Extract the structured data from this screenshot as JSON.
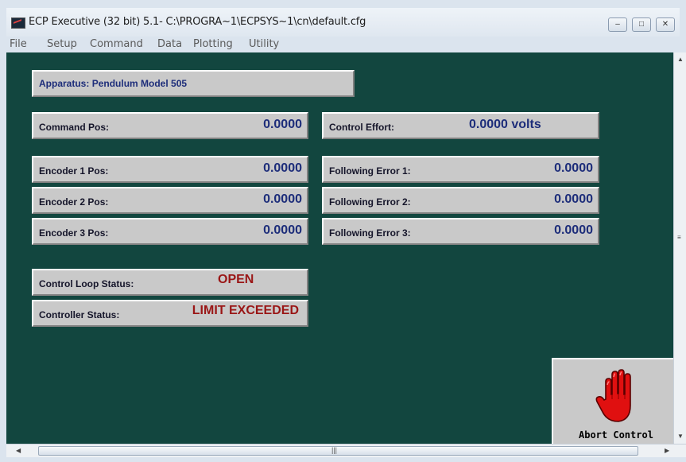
{
  "window": {
    "title": "ECP Executive (32 bit) 5.1- C:\\PROGRA~1\\ECPSYS~1\\cn\\default.cfg",
    "controls": [
      "minimize-icon",
      "maximize-icon",
      "close-icon"
    ]
  },
  "menu": {
    "items": [
      "File",
      "Setup",
      "Command",
      "Data",
      "Plotting",
      "Utility"
    ]
  },
  "apparatus": {
    "label": "Apparatus:",
    "value": "Pendulum Model 505"
  },
  "command_pos": {
    "label": "Command Pos:",
    "value": "0.0000"
  },
  "control_effort": {
    "label": "Control Effort:",
    "value": "0.0000 volts"
  },
  "encoders": [
    {
      "label": "Encoder 1 Pos:",
      "value": "0.0000"
    },
    {
      "label": "Encoder 2 Pos:",
      "value": "0.0000"
    },
    {
      "label": "Encoder 3 Pos:",
      "value": "0.0000"
    }
  ],
  "following_errors": [
    {
      "label": "Following Error 1:",
      "value": "0.0000"
    },
    {
      "label": "Following Error 2:",
      "value": "0.0000"
    },
    {
      "label": "Following Error 3:",
      "value": "0.0000"
    }
  ],
  "control_loop_status": {
    "label": "Control Loop Status:",
    "value": "OPEN"
  },
  "controller_status": {
    "label": "Controller Status:",
    "value": "LIMIT EXCEEDED"
  },
  "abort": {
    "label": "Abort Control",
    "icon": "stop-hand-icon"
  },
  "colors": {
    "background": "#12463f",
    "panel": "#c9c9c9",
    "value_blue": "#1d2d7a",
    "status_red": "#9a1616",
    "hand_red": "#e01010"
  }
}
